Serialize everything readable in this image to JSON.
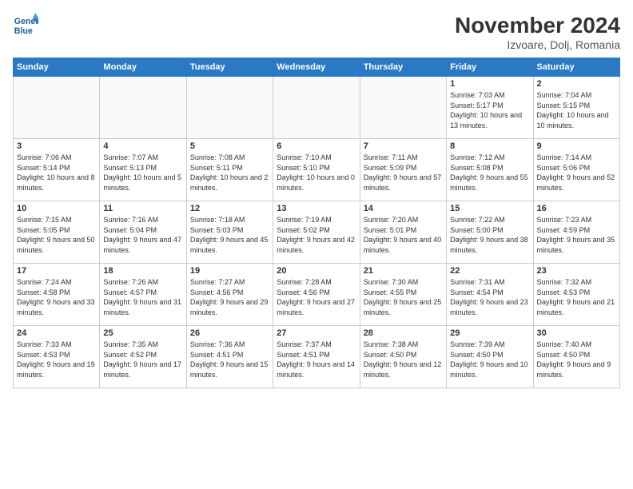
{
  "header": {
    "logo_line1": "General",
    "logo_line2": "Blue",
    "month": "November 2024",
    "location": "Izvoare, Dolj, Romania"
  },
  "weekdays": [
    "Sunday",
    "Monday",
    "Tuesday",
    "Wednesday",
    "Thursday",
    "Friday",
    "Saturday"
  ],
  "weeks": [
    [
      {
        "day": "",
        "empty": true
      },
      {
        "day": "",
        "empty": true
      },
      {
        "day": "",
        "empty": true
      },
      {
        "day": "",
        "empty": true
      },
      {
        "day": "",
        "empty": true
      },
      {
        "day": "1",
        "sunrise": "Sunrise: 7:03 AM",
        "sunset": "Sunset: 5:17 PM",
        "daylight": "Daylight: 10 hours and 13 minutes."
      },
      {
        "day": "2",
        "sunrise": "Sunrise: 7:04 AM",
        "sunset": "Sunset: 5:15 PM",
        "daylight": "Daylight: 10 hours and 10 minutes."
      }
    ],
    [
      {
        "day": "3",
        "sunrise": "Sunrise: 7:06 AM",
        "sunset": "Sunset: 5:14 PM",
        "daylight": "Daylight: 10 hours and 8 minutes."
      },
      {
        "day": "4",
        "sunrise": "Sunrise: 7:07 AM",
        "sunset": "Sunset: 5:13 PM",
        "daylight": "Daylight: 10 hours and 5 minutes."
      },
      {
        "day": "5",
        "sunrise": "Sunrise: 7:08 AM",
        "sunset": "Sunset: 5:11 PM",
        "daylight": "Daylight: 10 hours and 2 minutes."
      },
      {
        "day": "6",
        "sunrise": "Sunrise: 7:10 AM",
        "sunset": "Sunset: 5:10 PM",
        "daylight": "Daylight: 10 hours and 0 minutes."
      },
      {
        "day": "7",
        "sunrise": "Sunrise: 7:11 AM",
        "sunset": "Sunset: 5:09 PM",
        "daylight": "Daylight: 9 hours and 57 minutes."
      },
      {
        "day": "8",
        "sunrise": "Sunrise: 7:12 AM",
        "sunset": "Sunset: 5:08 PM",
        "daylight": "Daylight: 9 hours and 55 minutes."
      },
      {
        "day": "9",
        "sunrise": "Sunrise: 7:14 AM",
        "sunset": "Sunset: 5:06 PM",
        "daylight": "Daylight: 9 hours and 52 minutes."
      }
    ],
    [
      {
        "day": "10",
        "sunrise": "Sunrise: 7:15 AM",
        "sunset": "Sunset: 5:05 PM",
        "daylight": "Daylight: 9 hours and 50 minutes."
      },
      {
        "day": "11",
        "sunrise": "Sunrise: 7:16 AM",
        "sunset": "Sunset: 5:04 PM",
        "daylight": "Daylight: 9 hours and 47 minutes."
      },
      {
        "day": "12",
        "sunrise": "Sunrise: 7:18 AM",
        "sunset": "Sunset: 5:03 PM",
        "daylight": "Daylight: 9 hours and 45 minutes."
      },
      {
        "day": "13",
        "sunrise": "Sunrise: 7:19 AM",
        "sunset": "Sunset: 5:02 PM",
        "daylight": "Daylight: 9 hours and 42 minutes."
      },
      {
        "day": "14",
        "sunrise": "Sunrise: 7:20 AM",
        "sunset": "Sunset: 5:01 PM",
        "daylight": "Daylight: 9 hours and 40 minutes."
      },
      {
        "day": "15",
        "sunrise": "Sunrise: 7:22 AM",
        "sunset": "Sunset: 5:00 PM",
        "daylight": "Daylight: 9 hours and 38 minutes."
      },
      {
        "day": "16",
        "sunrise": "Sunrise: 7:23 AM",
        "sunset": "Sunset: 4:59 PM",
        "daylight": "Daylight: 9 hours and 35 minutes."
      }
    ],
    [
      {
        "day": "17",
        "sunrise": "Sunrise: 7:24 AM",
        "sunset": "Sunset: 4:58 PM",
        "daylight": "Daylight: 9 hours and 33 minutes."
      },
      {
        "day": "18",
        "sunrise": "Sunrise: 7:26 AM",
        "sunset": "Sunset: 4:57 PM",
        "daylight": "Daylight: 9 hours and 31 minutes."
      },
      {
        "day": "19",
        "sunrise": "Sunrise: 7:27 AM",
        "sunset": "Sunset: 4:56 PM",
        "daylight": "Daylight: 9 hours and 29 minutes."
      },
      {
        "day": "20",
        "sunrise": "Sunrise: 7:28 AM",
        "sunset": "Sunset: 4:56 PM",
        "daylight": "Daylight: 9 hours and 27 minutes."
      },
      {
        "day": "21",
        "sunrise": "Sunrise: 7:30 AM",
        "sunset": "Sunset: 4:55 PM",
        "daylight": "Daylight: 9 hours and 25 minutes."
      },
      {
        "day": "22",
        "sunrise": "Sunrise: 7:31 AM",
        "sunset": "Sunset: 4:54 PM",
        "daylight": "Daylight: 9 hours and 23 minutes."
      },
      {
        "day": "23",
        "sunrise": "Sunrise: 7:32 AM",
        "sunset": "Sunset: 4:53 PM",
        "daylight": "Daylight: 9 hours and 21 minutes."
      }
    ],
    [
      {
        "day": "24",
        "sunrise": "Sunrise: 7:33 AM",
        "sunset": "Sunset: 4:53 PM",
        "daylight": "Daylight: 9 hours and 19 minutes."
      },
      {
        "day": "25",
        "sunrise": "Sunrise: 7:35 AM",
        "sunset": "Sunset: 4:52 PM",
        "daylight": "Daylight: 9 hours and 17 minutes."
      },
      {
        "day": "26",
        "sunrise": "Sunrise: 7:36 AM",
        "sunset": "Sunset: 4:51 PM",
        "daylight": "Daylight: 9 hours and 15 minutes."
      },
      {
        "day": "27",
        "sunrise": "Sunrise: 7:37 AM",
        "sunset": "Sunset: 4:51 PM",
        "daylight": "Daylight: 9 hours and 14 minutes."
      },
      {
        "day": "28",
        "sunrise": "Sunrise: 7:38 AM",
        "sunset": "Sunset: 4:50 PM",
        "daylight": "Daylight: 9 hours and 12 minutes."
      },
      {
        "day": "29",
        "sunrise": "Sunrise: 7:39 AM",
        "sunset": "Sunset: 4:50 PM",
        "daylight": "Daylight: 9 hours and 10 minutes."
      },
      {
        "day": "30",
        "sunrise": "Sunrise: 7:40 AM",
        "sunset": "Sunset: 4:50 PM",
        "daylight": "Daylight: 9 hours and 9 minutes."
      }
    ]
  ]
}
